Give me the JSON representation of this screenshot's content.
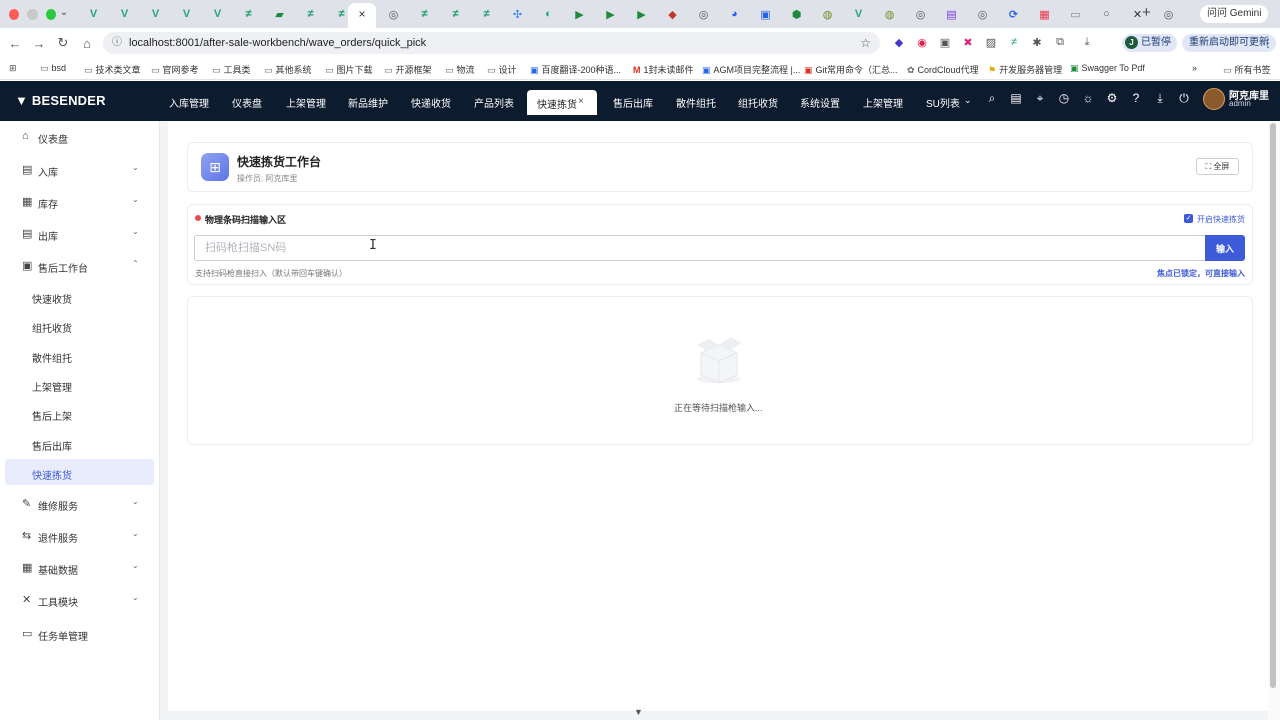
{
  "browser": {
    "url": "localhost:8001/after-sale-workbench/wave_orders/quick_pick",
    "active_tab_close": "×",
    "new_tab": "+",
    "gemini_label": "问问 Gemini",
    "paused_label": "已暂停",
    "paused_avatar": "J",
    "relaunch_label": "重新启动即可更新",
    "bookmarks": [
      "bsd",
      "技术类文章",
      "官网参考",
      "工具类",
      "其他系统",
      "图片下载",
      "开源框架",
      "物流",
      "设计",
      "百度翻译-200种语...",
      "1封未读邮件",
      "AGM项目完整流程 |...",
      "Git常用命令（汇总...",
      "CordCloud代理",
      "开发服务器管理",
      "Swagger To Pdf",
      "所有书签"
    ]
  },
  "app": {
    "logo": "BESENDER",
    "menu": [
      "入库管理",
      "仪表盘",
      "上架管理",
      "新品维护",
      "快递收货",
      "产品列表",
      "售后出库",
      "散件组托",
      "组托收货",
      "系统设置",
      "上架管理",
      "SU列表"
    ],
    "active_menu": "快速拣货",
    "active_menu_close": "×",
    "user": {
      "name": "阿克库里",
      "role": "admin"
    }
  },
  "sidebar": {
    "items": [
      {
        "label": "仪表盘",
        "icon": "home-icon"
      },
      {
        "label": "入库",
        "icon": "inbound-icon"
      },
      {
        "label": "库存",
        "icon": "inventory-icon"
      },
      {
        "label": "出库",
        "icon": "outbound-icon"
      },
      {
        "label": "售后工作台",
        "icon": "aftersale-icon"
      }
    ],
    "sub_items": [
      "快速收货",
      "组托收货",
      "散件组托",
      "上架管理",
      "售后上架",
      "售后出库",
      "快速拣货"
    ],
    "bottom_items": [
      {
        "label": "维修服务",
        "icon": "wrench-icon"
      },
      {
        "label": "退件服务",
        "icon": "return-icon"
      },
      {
        "label": "基础数据",
        "icon": "database-icon"
      },
      {
        "label": "工具模块",
        "icon": "tools-icon"
      },
      {
        "label": "任务单管理",
        "icon": "task-icon"
      }
    ]
  },
  "workbench": {
    "title": "快速拣货工作台",
    "operator": "操作员: 阿克库里",
    "fullscreen_label": "全屏"
  },
  "scan": {
    "title": "物理条码扫描输入区",
    "toggle_label": "开启快速拣货",
    "toggle_checked": true,
    "placeholder": "扫码枪扫描SN码",
    "value": "",
    "enter_label": "输入",
    "hint_left": "支持扫码枪直接扫入（默认带回车键确认）",
    "hint_right": "焦点已锁定，可直接输入"
  },
  "empty_state": {
    "text": "正在等待扫描枪输入..."
  },
  "colors": {
    "header_bg": "#0d1b2e",
    "primary": "#3d5bd9",
    "active_bg": "#e8ecfb",
    "status_dot": "#ee4a4a"
  }
}
